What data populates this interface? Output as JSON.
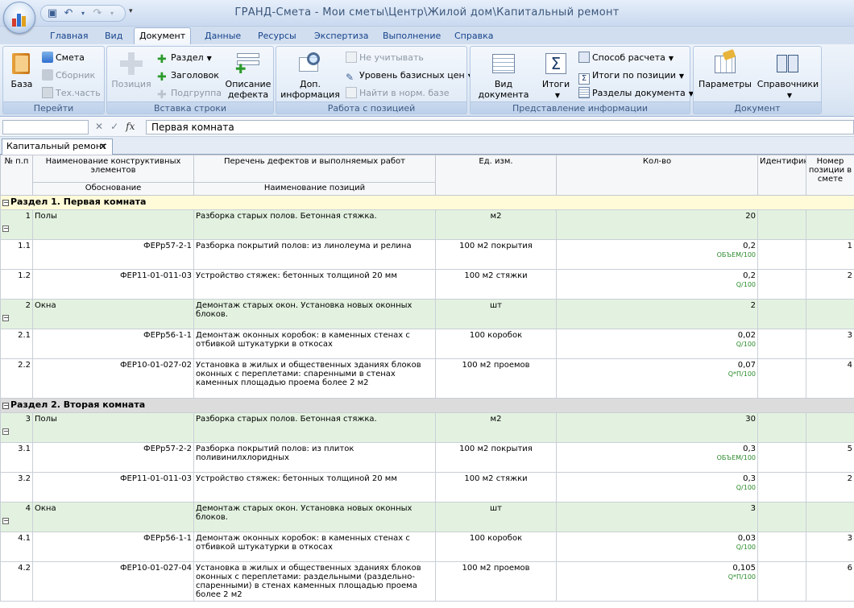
{
  "window": {
    "title": "ГРАНД-Смета - Мои сметы\\Центр\\Жилой дом\\Капитальный ремонт"
  },
  "ribbon_tabs": [
    "Главная",
    "Вид",
    "Документ",
    "Данные",
    "Ресурсы",
    "Экспертиза",
    "Выполнение",
    "Справка"
  ],
  "active_tab": "Документ",
  "groups": {
    "pereyti": {
      "label": "Перейти",
      "baza": "База",
      "smeta": "Смета",
      "sbornik": "Сборник",
      "techast": "Тех.часть"
    },
    "vstavka": {
      "label": "Вставка строки",
      "poziciya": "Позиция",
      "razdel": "Раздел",
      "zagolovok": "Заголовок",
      "podgruppa": "Подгруппа",
      "opisanie1": "Описание",
      "opisanie2": "дефекта"
    },
    "rabota": {
      "label": "Работа с позицией",
      "dop1": "Доп.",
      "dop2": "информация",
      "ne_uchit": "Не учитывать",
      "uroven": "Уровень базисных цен",
      "nayti": "Найти в норм. базе"
    },
    "predstavlenie": {
      "label": "Представление информации",
      "vid1": "Вид",
      "vid2": "документа",
      "itogi": "Итоги",
      "sposob": "Способ расчета",
      "itogi_poz": "Итоги по позиции",
      "razdely": "Разделы документа"
    },
    "dokument": {
      "label": "Документ",
      "parametry": "Параметры",
      "spravochniki": "Справочники"
    }
  },
  "formula_bar": {
    "value": "Первая комната",
    "fx": "fx"
  },
  "doc_tab": "Капитальный ремонт",
  "columns": {
    "num": "№ п.п",
    "element": "Наименование конструктивных элементов",
    "obosnovanie": "Обоснование",
    "perechen": "Перечень дефектов и выполняемых работ",
    "naim_poz": "Наименование позиций",
    "ed": "Ед. изм.",
    "kol": "Кол-во",
    "ident": "Идентификатор",
    "nomer": "Номер позиции в смете"
  },
  "sections": [
    {
      "title": "Раздел 1. Первая комната",
      "rows": [
        {
          "type": "pos",
          "num": "1",
          "element": "Полы",
          "work": "Разборка старых полов. Бетонная стяжка.",
          "unit": "м2",
          "qty": "20",
          "formula": "",
          "nomer": ""
        },
        {
          "type": "item",
          "num": "1.1",
          "element": "ФЕРр57-2-1",
          "work": "Разборка покрытий полов: из линолеума и релина",
          "unit": "100 м2 покрытия",
          "qty": "0,2",
          "formula": "ОБЪЕМ/100",
          "nomer": "1"
        },
        {
          "type": "item",
          "num": "1.2",
          "element": "ФЕР11-01-011-03",
          "work": "Устройство стяжек: бетонных толщиной 20 мм",
          "unit": "100 м2 стяжки",
          "qty": "0,2",
          "formula": "Q/100",
          "nomer": "2"
        },
        {
          "type": "pos",
          "num": "2",
          "element": "Окна",
          "work": "Демонтаж старых окон. Установка новых оконных блоков.",
          "unit": "шт",
          "qty": "2",
          "formula": "",
          "nomer": ""
        },
        {
          "type": "item",
          "num": "2.1",
          "element": "ФЕРр56-1-1",
          "work": "Демонтаж оконных коробок: в каменных стенах с отбивкой штукатурки в откосах",
          "unit": "100 коробок",
          "qty": "0,02",
          "formula": "Q/100",
          "nomer": "3"
        },
        {
          "type": "item",
          "num": "2.2",
          "element": "ФЕР10-01-027-02",
          "work": "Установка в жилых и общественных зданиях блоков оконных с переплетами: спаренными в стенах каменных площадью проема более 2 м2",
          "unit": "100 м2 проемов",
          "qty": "0,07",
          "formula": "Q*П/100",
          "nomer": "4"
        }
      ]
    },
    {
      "title": "Раздел 2. Вторая комната",
      "rows": [
        {
          "type": "pos",
          "num": "3",
          "element": "Полы",
          "work": "Разборка старых полов. Бетонная стяжка.",
          "unit": "м2",
          "qty": "30",
          "formula": "",
          "nomer": ""
        },
        {
          "type": "item",
          "num": "3.1",
          "element": "ФЕРр57-2-2",
          "work": "Разборка покрытий полов: из плиток поливинилхлоридных",
          "unit": "100 м2 покрытия",
          "qty": "0,3",
          "formula": "ОБЪЕМ/100",
          "nomer": "5"
        },
        {
          "type": "item",
          "num": "3.2",
          "element": "ФЕР11-01-011-03",
          "work": "Устройство стяжек: бетонных толщиной 20 мм",
          "unit": "100 м2 стяжки",
          "qty": "0,3",
          "formula": "Q/100",
          "nomer": "2"
        },
        {
          "type": "pos",
          "num": "4",
          "element": "Окна",
          "work": "Демонтаж старых окон. Установка новых оконных блоков.",
          "unit": "шт",
          "qty": "3",
          "formula": "",
          "nomer": ""
        },
        {
          "type": "item",
          "num": "4.1",
          "element": "ФЕРр56-1-1",
          "work": "Демонтаж оконных коробок: в каменных стенах с отбивкой штукатурки в откосах",
          "unit": "100 коробок",
          "qty": "0,03",
          "formula": "Q/100",
          "nomer": "3"
        },
        {
          "type": "item",
          "num": "4.2",
          "element": "ФЕР10-01-027-04",
          "work": "Установка в жилых и общественных зданиях блоков оконных с переплетами: раздельными (раздельно-спаренными) в стенах каменных площадью проема более 2 м2",
          "unit": "100 м2 проемов",
          "qty": "0,105",
          "formula": "Q*П/100",
          "nomer": "6"
        }
      ]
    }
  ]
}
